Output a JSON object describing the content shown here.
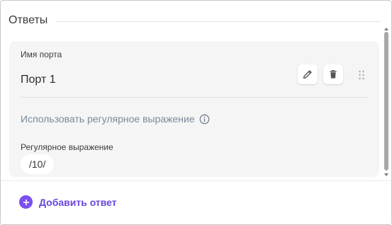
{
  "section": {
    "title": "Ответы"
  },
  "answer": {
    "port_label": "Имя порта",
    "port_value": "Порт 1",
    "use_regex_label": "Использовать регулярное выражение",
    "regex_label": "Регулярное выражение",
    "regex_value": "/10/"
  },
  "icons": {
    "edit": "pencil-icon",
    "delete": "trash-icon",
    "drag": "drag-handle-icon",
    "info": "info-icon",
    "add": "plus-icon"
  },
  "footer": {
    "add_label": "Добавить ответ"
  },
  "colors": {
    "accent": "#7b4ff0",
    "muted_text": "#7a8a99",
    "card_bg": "#f5f5f6"
  }
}
